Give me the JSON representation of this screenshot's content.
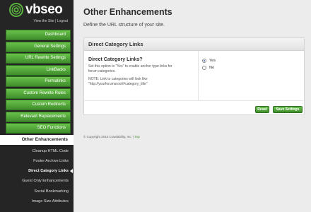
{
  "brand": {
    "name": "vbseo",
    "links": [
      "View the Site",
      "Logout"
    ],
    "separator": " | "
  },
  "sidebar": {
    "sections": [
      {
        "label": "Dashboard"
      },
      {
        "label": "General Settings"
      },
      {
        "label": "URL Rewrite Settings"
      },
      {
        "label": "LinkBacks"
      },
      {
        "label": "Permalinks"
      },
      {
        "label": "Custom Rewrite Rules"
      },
      {
        "label": "Custom Redirects"
      },
      {
        "label": "Relevant Replacements"
      },
      {
        "label": "SEO Functions"
      }
    ],
    "active_section": "Other Enhancements",
    "sub_items": [
      {
        "label": "Cleanup HTML Code"
      },
      {
        "label": "Footer Archive Links"
      },
      {
        "label": "Direct Category Links"
      },
      {
        "label": "Guest Only Enhancements"
      },
      {
        "label": "Social Bookmarking"
      },
      {
        "label": "Image Size Attributes"
      }
    ]
  },
  "main": {
    "title": "Other Enhancements",
    "description": "Define the URL structure of your site.",
    "panel": {
      "header": "Direct Category Links",
      "option_title": "Direct Category Links?",
      "option_desc_1": "Set this option to \"Yes\" to enable anchor type links for",
      "option_desc_2": "forum categories.",
      "note_1": "NOTE: Link to categories will look like",
      "note_2": "\"http://yourforumsroot/#category_title\"",
      "radio_yes": "Yes",
      "radio_no": "No",
      "selected": "Yes",
      "reset_label": "Reset",
      "save_label": "Save Settings"
    }
  },
  "footer": {
    "copyright": "© Copyright 2010 Crawlability, Inc. |",
    "top_link": "Top"
  },
  "colors": {
    "accent_green": "#4fa63a",
    "sidebar_bg": "#252525",
    "page_bg": "#ececec"
  }
}
